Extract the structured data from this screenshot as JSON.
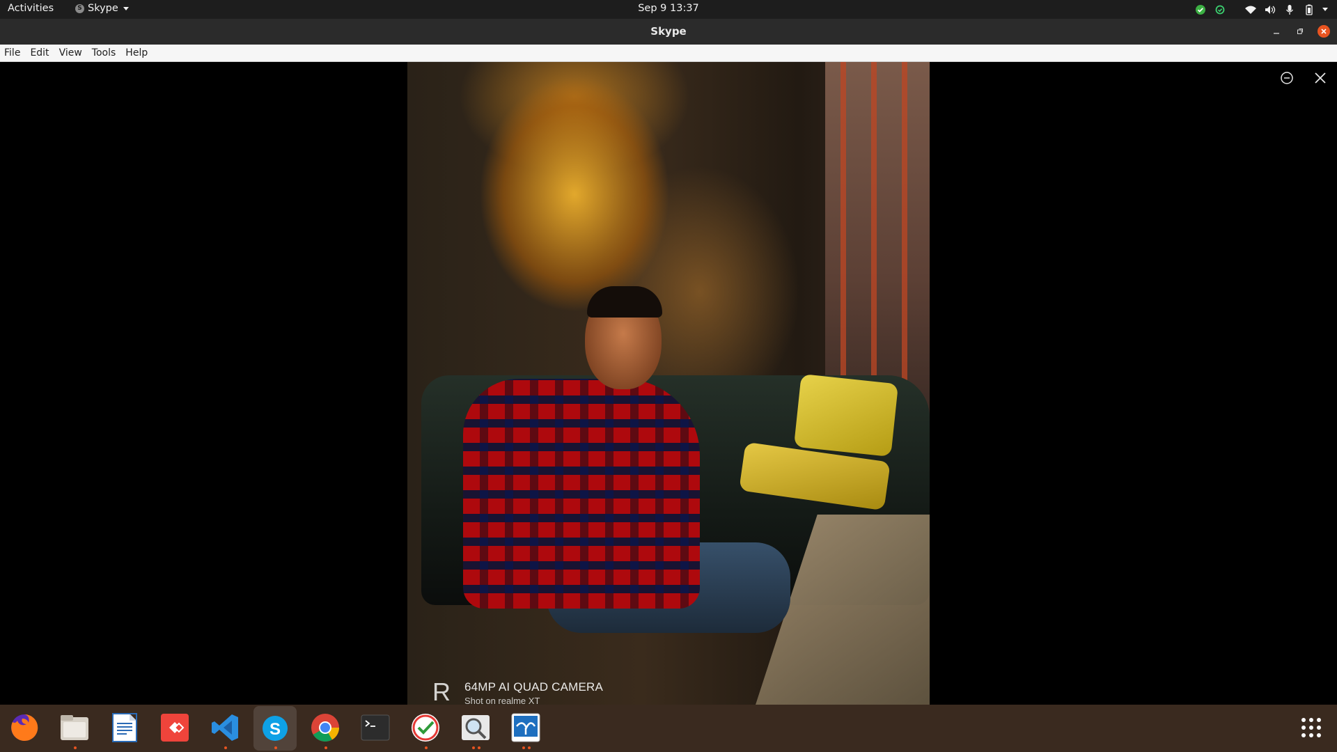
{
  "topbar": {
    "activities": "Activities",
    "app_name": "Skype",
    "clock": "Sep 9  13:37"
  },
  "window": {
    "title": "Skype"
  },
  "menubar": {
    "items": [
      "File",
      "Edit",
      "View",
      "Tools",
      "Help"
    ]
  },
  "photo": {
    "watermark_line1": "64MP AI QUAD CAMERA",
    "watermark_line2": "Shot on realme XT",
    "watermark_logo": "R"
  },
  "dock": {
    "apps": [
      "firefox",
      "files",
      "libreoffice-writer",
      "anydesk",
      "vscode",
      "skype",
      "chrome",
      "terminal",
      "task-checker",
      "image-viewer",
      "bluefish"
    ]
  },
  "colors": {
    "accent": "#e95420",
    "topbar_bg": "#1d1d1d",
    "titlebar_bg": "#2b2b2b",
    "dock_bg": "#3a2a1f"
  }
}
